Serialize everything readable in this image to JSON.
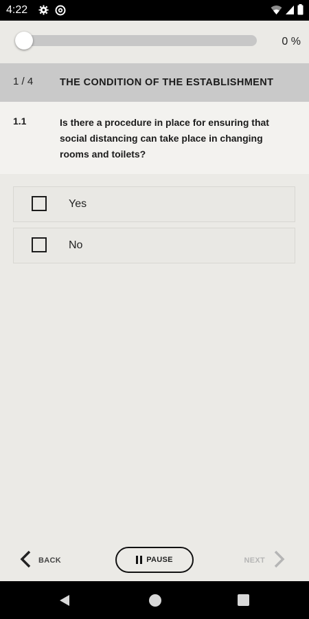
{
  "status_bar": {
    "time": "4:22",
    "left_icons": [
      "gear-icon",
      "at-sign-icon"
    ],
    "right_icons": [
      "wifi-icon",
      "signal-icon",
      "battery-icon"
    ]
  },
  "progress": {
    "value_percent": 0,
    "label": "0 %"
  },
  "section": {
    "number": "1 / 4",
    "title": "THE CONDITION OF THE ESTABLISHMENT"
  },
  "question": {
    "number": "1.1",
    "text": "Is there a procedure in place for ensuring that social distancing can take place in changing rooms and toilets?"
  },
  "options": [
    {
      "label": "Yes",
      "checked": false
    },
    {
      "label": "No",
      "checked": false
    }
  ],
  "footer": {
    "back_label": "BACK",
    "pause_label": "PAUSE",
    "next_label": "NEXT",
    "next_enabled": false
  },
  "colors": {
    "background": "#ebeae6",
    "section_header": "#c9c9c9",
    "disabled_text": "#b5b5b5"
  }
}
